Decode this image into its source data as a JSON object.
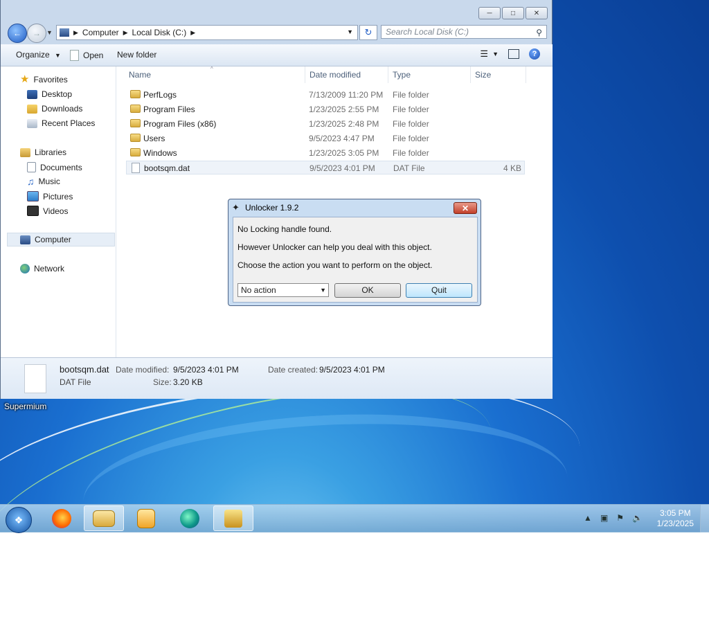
{
  "explorer": {
    "address": {
      "crumbs": [
        "Computer",
        "Local Disk (C:)"
      ]
    },
    "search_placeholder": "Search Local Disk (C:)",
    "toolbar": {
      "organize": "Organize",
      "open": "Open",
      "new_folder": "New folder"
    },
    "nav": {
      "favorites": "Favorites",
      "desktop": "Desktop",
      "downloads": "Downloads",
      "recent": "Recent Places",
      "libraries": "Libraries",
      "documents": "Documents",
      "music": "Music",
      "pictures": "Pictures",
      "videos": "Videos",
      "computer": "Computer",
      "network": "Network"
    },
    "columns": {
      "name": "Name",
      "date": "Date modified",
      "type": "Type",
      "size": "Size"
    },
    "files": [
      {
        "name": "PerfLogs",
        "date": "7/13/2009 11:20 PM",
        "type": "File folder",
        "size": ""
      },
      {
        "name": "Program Files",
        "date": "1/23/2025 2:55 PM",
        "type": "File folder",
        "size": ""
      },
      {
        "name": "Program Files (x86)",
        "date": "1/23/2025 2:48 PM",
        "type": "File folder",
        "size": ""
      },
      {
        "name": "Users",
        "date": "9/5/2023 4:47 PM",
        "type": "File folder",
        "size": ""
      },
      {
        "name": "Windows",
        "date": "1/23/2025 3:05 PM",
        "type": "File folder",
        "size": ""
      },
      {
        "name": "bootsqm.dat",
        "date": "9/5/2023 4:01 PM",
        "type": "DAT File",
        "size": "4 KB"
      }
    ],
    "details": {
      "filename": "bootsqm.dat",
      "filetype": "DAT File",
      "modified_label": "Date modified:",
      "modified_value": "9/5/2023 4:01 PM",
      "size_label": "Size:",
      "size_value": "3.20 KB",
      "created_label": "Date created:",
      "created_value": "9/5/2023 4:01 PM"
    }
  },
  "desktop": {
    "icon_label": "Supermium"
  },
  "dialog": {
    "title": "Unlocker 1.9.2",
    "line1": "No Locking handle found.",
    "line2": "However Unlocker can help you deal with this object.",
    "line3": "Choose the action you want to perform on the object.",
    "select_value": "No action",
    "ok": "OK",
    "quit": "Quit"
  },
  "taskbar": {
    "time": "3:05 PM",
    "date": "1/23/2025"
  }
}
